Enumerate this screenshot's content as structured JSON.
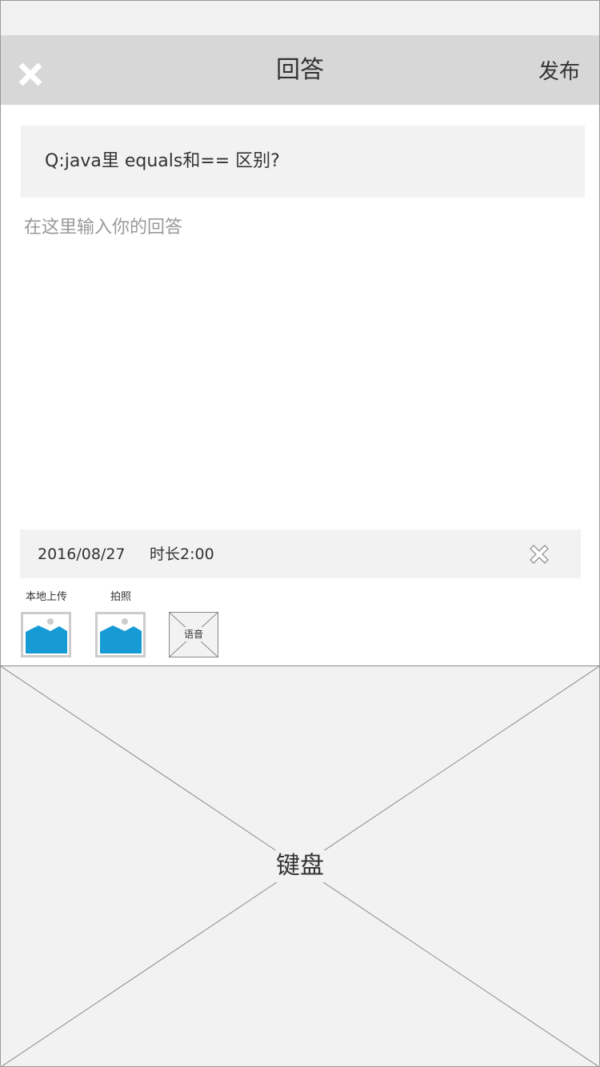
{
  "header": {
    "title": "回答",
    "publish_label": "发布",
    "close_icon": "close-icon"
  },
  "question": {
    "text": "Q:java里 equals和== 区别?"
  },
  "answer": {
    "placeholder": "在这里输入你的回答"
  },
  "voice_record": {
    "date": "2016/08/27",
    "duration": "时长2:00",
    "delete_icon": "close-outline-icon"
  },
  "tools": {
    "local_upload_label": "本地上传",
    "camera_label": "拍照",
    "voice_label": "语音",
    "image_icon": "image-icon"
  },
  "keyboard": {
    "label": "键盘"
  },
  "colors": {
    "nav_bg": "#d7d7d7",
    "panel_bg": "#f2f2f2",
    "image_blue": "#169bd5",
    "text": "#333333",
    "placeholder": "#999999"
  }
}
